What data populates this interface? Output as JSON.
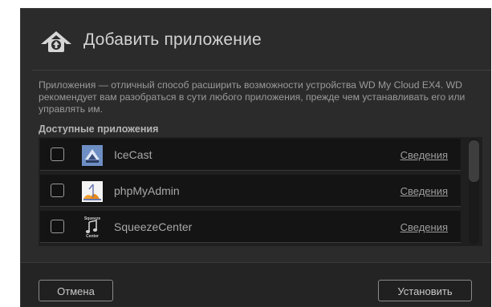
{
  "dialog": {
    "title": "Добавить приложение",
    "description": "Приложения — отличный способ расширить возможности устройства WD My Cloud EX4. WD рекомендует вам разобраться в сути любого приложения, прежде чем устанавливать его или управлять им.",
    "section_title": "Доступные приложения",
    "header_icon": "cloud-app-icon",
    "apps": [
      {
        "name": "IceCast",
        "details": "Сведения",
        "icon": "icecast-icon",
        "checked": false
      },
      {
        "name": "phpMyAdmin",
        "details": "Сведения",
        "icon": "phpmyadmin-icon",
        "checked": false
      },
      {
        "name": "SqueezeCenter",
        "details": "Сведения",
        "icon": "squeezecenter-icon",
        "checked": false,
        "icon_text": [
          "Squeeze",
          "Center"
        ]
      }
    ]
  },
  "footer": {
    "cancel_label": "Отмена",
    "install_label": "Установить"
  },
  "colors": {
    "dialog_bg": "#2b2b2b",
    "row_bg": "#141414",
    "text_muted": "#9a9a9a"
  }
}
